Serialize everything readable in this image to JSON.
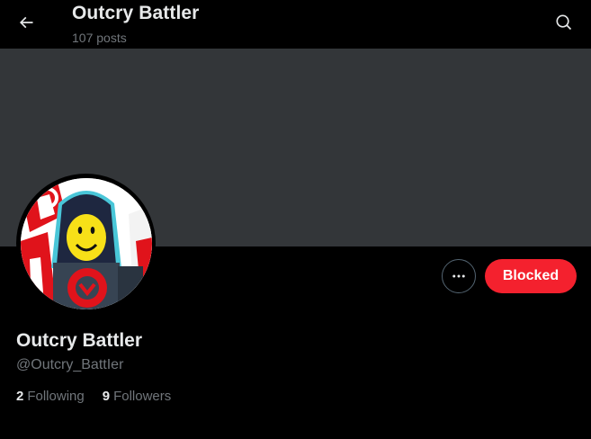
{
  "header": {
    "title": "Outcry Battler",
    "posts_count": "107 posts"
  },
  "profile": {
    "display_name": "Outcry Battler",
    "handle": "@Outcry_BattIer",
    "following_count": "2",
    "following_label": "Following",
    "followers_count": "9",
    "followers_label": "Followers"
  },
  "actions": {
    "blocked_label": "Blocked"
  },
  "icons": {
    "back": "arrow-left-icon",
    "search": "search-icon",
    "more": "more-horizontal-icon"
  },
  "colors": {
    "background": "#000000",
    "banner": "#333639",
    "blocked_button": "#f4212e",
    "muted_text": "#71767b"
  }
}
